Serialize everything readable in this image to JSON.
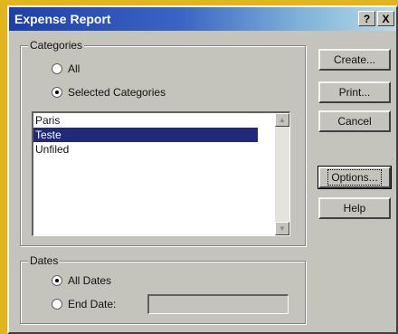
{
  "window": {
    "title": "Expense Report",
    "help_label": "?",
    "close_label": "X"
  },
  "categories": {
    "group_label": "Categories",
    "option_all": "All",
    "option_selected": "Selected Categories",
    "selected_option": "Selected Categories",
    "items": [
      {
        "label": "Paris",
        "selected": false
      },
      {
        "label": "Teste",
        "selected": true
      },
      {
        "label": "Unfiled",
        "selected": false
      }
    ]
  },
  "dates": {
    "group_label": "Dates",
    "option_all": "All Dates",
    "option_end": "End Date:",
    "selected_option": "All Dates",
    "end_date_value": ""
  },
  "buttons": {
    "create": "Create...",
    "print": "Print...",
    "cancel": "Cancel",
    "options": "Options...",
    "help": "Help"
  },
  "colors": {
    "title_start": "#1e3fa8",
    "title_end": "#b8dce8",
    "selection": "#1f2a7a",
    "background": "#e2b51f"
  }
}
